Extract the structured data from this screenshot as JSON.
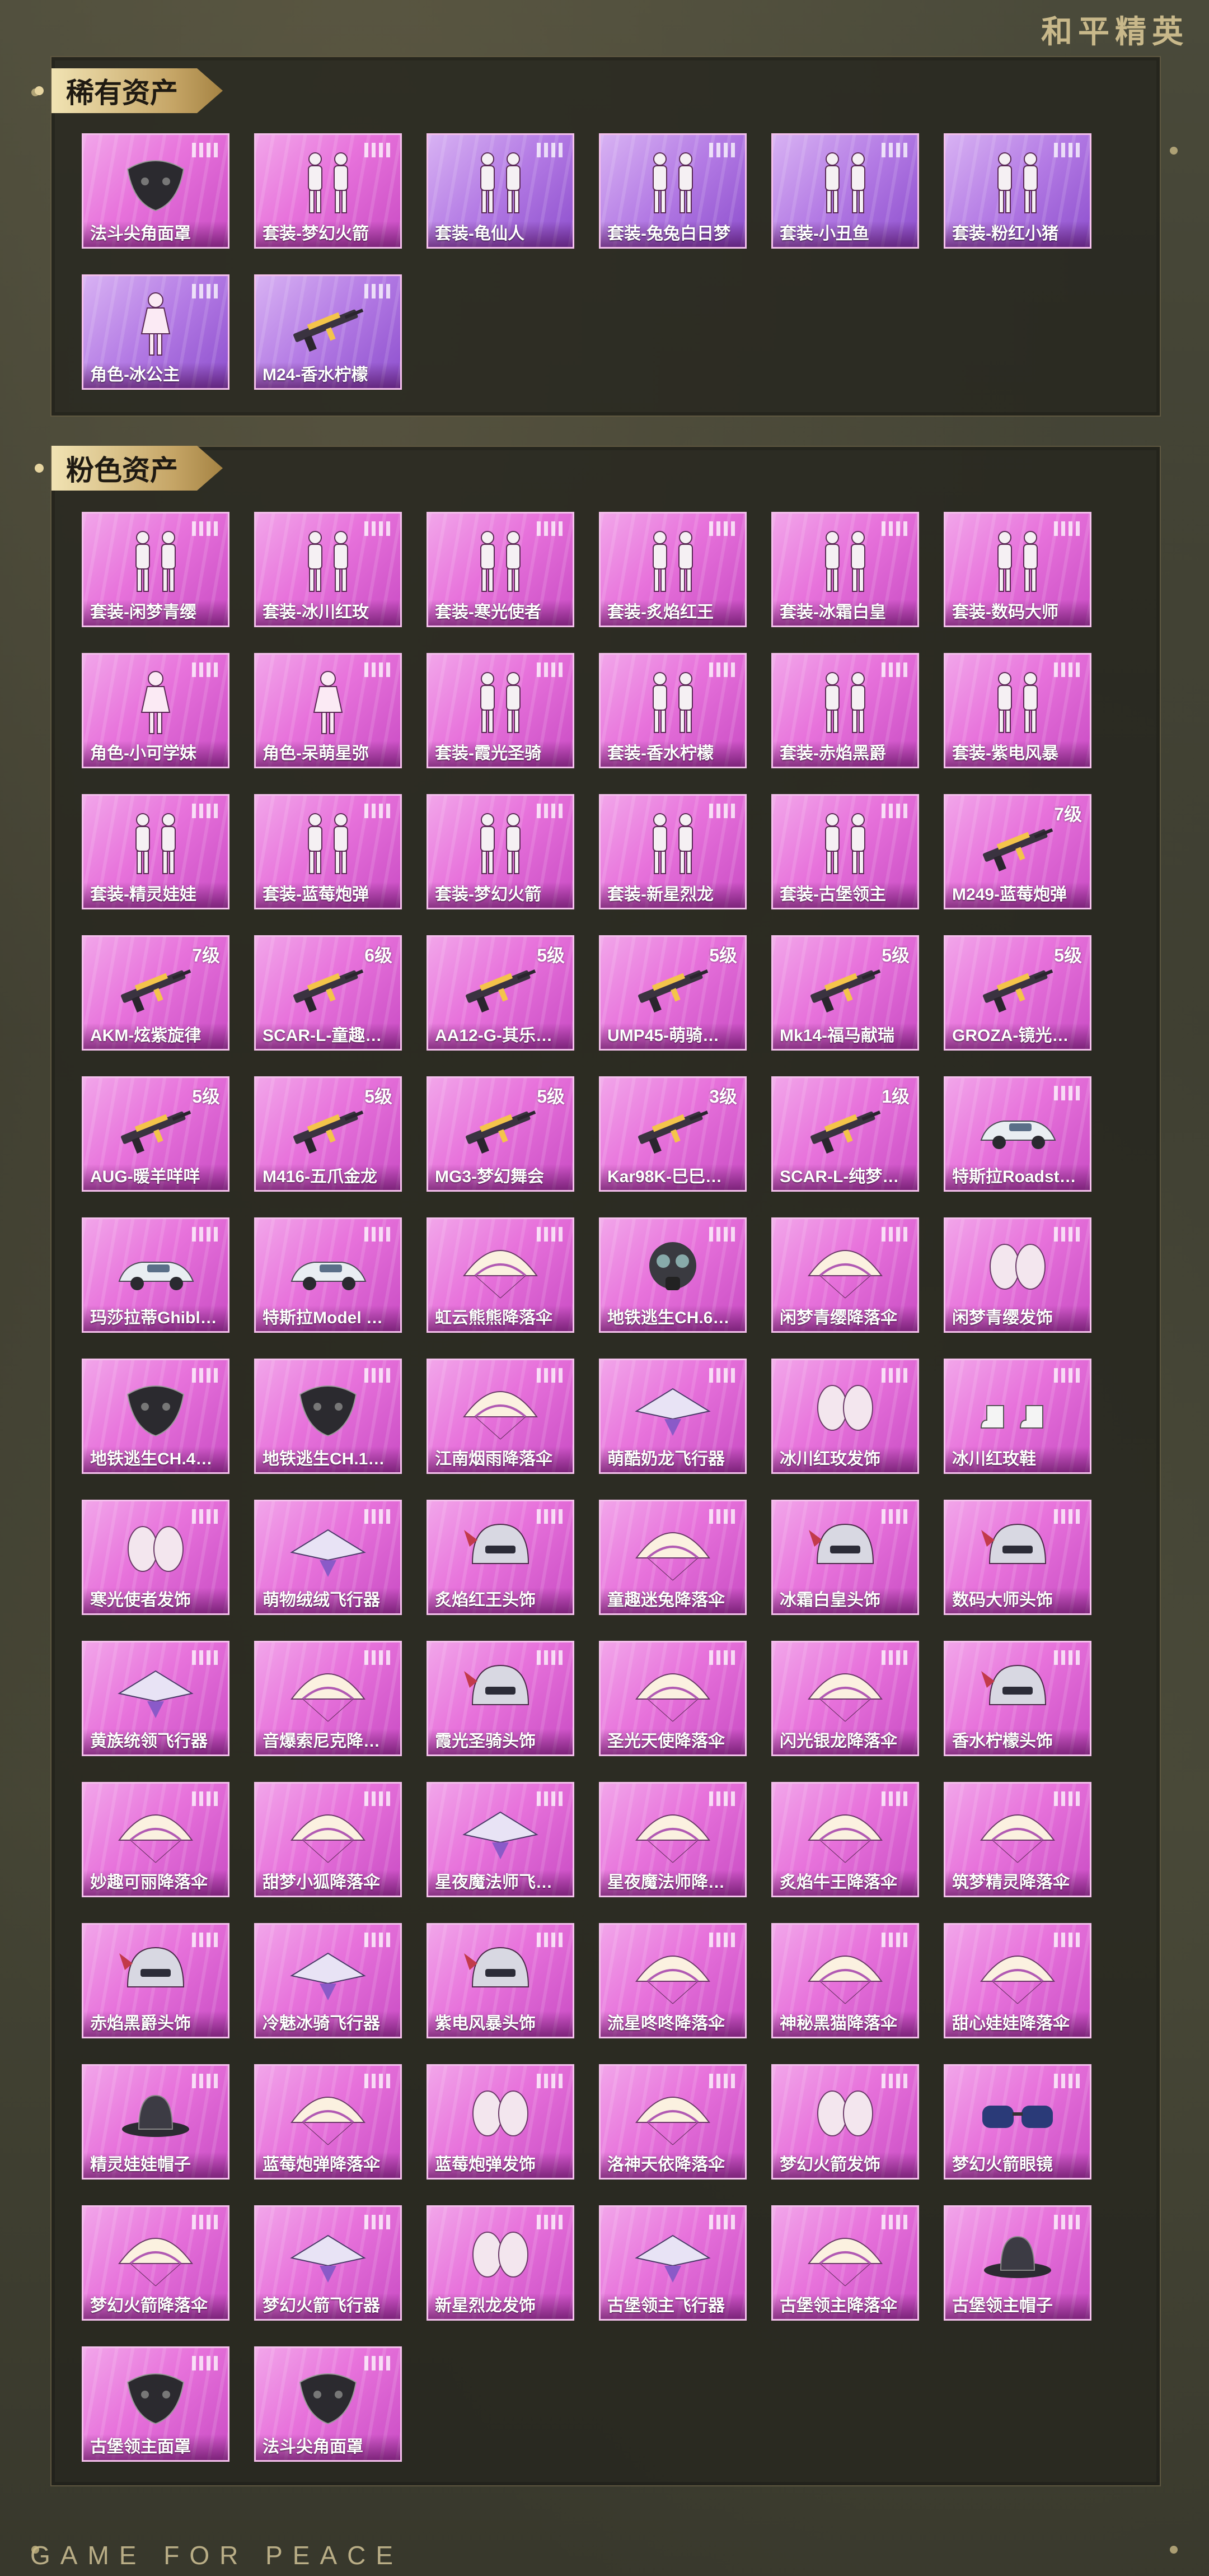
{
  "brand_title": "和平精英",
  "footer_text": "GAME FOR PEACE",
  "colors": {
    "pink": "#e772db",
    "purple": "#b37ae4",
    "gold": "#c6a667"
  },
  "sections": [
    {
      "title": "稀有资产",
      "items": [
        {
          "label": "法斗尖角面罩",
          "icon": "mask-icon",
          "level": "",
          "tone": "pink"
        },
        {
          "label": "套装-梦幻火箭",
          "icon": "outfit-icon",
          "level": "",
          "tone": "pink"
        },
        {
          "label": "套装-龟仙人",
          "icon": "outfit-icon",
          "level": "",
          "tone": "purple"
        },
        {
          "label": "套装-兔兔白日梦",
          "icon": "outfit-icon",
          "level": "",
          "tone": "purple"
        },
        {
          "label": "套装-小丑鱼",
          "icon": "outfit-icon",
          "level": "",
          "tone": "purple"
        },
        {
          "label": "套装-粉红小猪",
          "icon": "outfit-icon",
          "level": "",
          "tone": "purple"
        },
        {
          "label": "角色-冰公主",
          "icon": "character-icon",
          "level": "",
          "tone": "purple"
        },
        {
          "label": "M24-香水柠檬",
          "icon": "rifle-icon",
          "level": "",
          "tone": "purple"
        }
      ]
    },
    {
      "title": "粉色资产",
      "items": [
        {
          "label": "套装-闲梦青缨",
          "icon": "outfit-icon",
          "level": "",
          "tone": "pink"
        },
        {
          "label": "套装-冰川红玫",
          "icon": "outfit-icon",
          "level": "",
          "tone": "pink"
        },
        {
          "label": "套装-寒光使者",
          "icon": "outfit-icon",
          "level": "",
          "tone": "pink"
        },
        {
          "label": "套装-炙焰红王",
          "icon": "outfit-icon",
          "level": "",
          "tone": "pink"
        },
        {
          "label": "套装-冰霜白皇",
          "icon": "outfit-icon",
          "level": "",
          "tone": "pink"
        },
        {
          "label": "套装-数码大师",
          "icon": "outfit-icon",
          "level": "",
          "tone": "pink"
        },
        {
          "label": "角色-小可学妹",
          "icon": "character-icon",
          "level": "",
          "tone": "pink"
        },
        {
          "label": "角色-呆萌星弥",
          "icon": "character-icon",
          "level": "",
          "tone": "pink"
        },
        {
          "label": "套装-霞光圣骑",
          "icon": "outfit-icon",
          "level": "",
          "tone": "pink"
        },
        {
          "label": "套装-香水柠檬",
          "icon": "outfit-icon",
          "level": "",
          "tone": "pink"
        },
        {
          "label": "套装-赤焰黑爵",
          "icon": "outfit-icon",
          "level": "",
          "tone": "pink"
        },
        {
          "label": "套装-紫电风暴",
          "icon": "outfit-icon",
          "level": "",
          "tone": "pink"
        },
        {
          "label": "套装-精灵娃娃",
          "icon": "outfit-icon",
          "level": "",
          "tone": "pink"
        },
        {
          "label": "套装-蓝莓炮弹",
          "icon": "outfit-icon",
          "level": "",
          "tone": "pink"
        },
        {
          "label": "套装-梦幻火箭",
          "icon": "outfit-icon",
          "level": "",
          "tone": "pink"
        },
        {
          "label": "套装-新星烈龙",
          "icon": "outfit-icon",
          "level": "",
          "tone": "pink"
        },
        {
          "label": "套装-古堡领主",
          "icon": "outfit-icon",
          "level": "",
          "tone": "pink"
        },
        {
          "label": "M249-蓝莓炮弹",
          "icon": "rifle-icon",
          "level": "7级",
          "tone": "pink"
        },
        {
          "label": "AKM-炫紫旋律",
          "icon": "rifle-icon",
          "level": "7级",
          "tone": "pink"
        },
        {
          "label": "SCAR-L-童趣…",
          "icon": "rifle-icon",
          "level": "6级",
          "tone": "pink"
        },
        {
          "label": "AA12-G-其乐…",
          "icon": "rifle-icon",
          "level": "5级",
          "tone": "pink"
        },
        {
          "label": "UMP45-萌骑…",
          "icon": "rifle-icon",
          "level": "5级",
          "tone": "pink"
        },
        {
          "label": "Mk14-福马献瑞",
          "icon": "rifle-icon",
          "level": "5级",
          "tone": "pink"
        },
        {
          "label": "GROZA-镜光…",
          "icon": "rifle-icon",
          "level": "5级",
          "tone": "pink"
        },
        {
          "label": "AUG-暖羊咩咩",
          "icon": "rifle-icon",
          "level": "5级",
          "tone": "pink"
        },
        {
          "label": "M416-五爪金龙",
          "icon": "rifle-icon",
          "level": "5级",
          "tone": "pink"
        },
        {
          "label": "MG3-梦幻舞会",
          "icon": "rifle-icon",
          "level": "5级",
          "tone": "pink"
        },
        {
          "label": "Kar98K-巳巳…",
          "icon": "rifle-icon",
          "level": "3级",
          "tone": "pink"
        },
        {
          "label": "SCAR-L-纯梦…",
          "icon": "rifle-icon",
          "level": "1级",
          "tone": "pink"
        },
        {
          "label": "特斯拉Roadst…",
          "icon": "car-icon",
          "level": "",
          "tone": "pink"
        },
        {
          "label": "玛莎拉蒂Ghibl…",
          "icon": "car-icon",
          "level": "",
          "tone": "pink"
        },
        {
          "label": "特斯拉Model …",
          "icon": "car-icon",
          "level": "",
          "tone": "pink"
        },
        {
          "label": "虹云熊熊降落伞",
          "icon": "parachute-icon",
          "level": "",
          "tone": "pink"
        },
        {
          "label": "地铁逃生CH.6…",
          "icon": "gasmask-icon",
          "level": "",
          "tone": "pink"
        },
        {
          "label": "闲梦青缨降落伞",
          "icon": "parachute-icon",
          "level": "",
          "tone": "pink"
        },
        {
          "label": "闲梦青缨发饰",
          "icon": "hair-icon",
          "level": "",
          "tone": "pink"
        },
        {
          "label": "地铁逃生CH.4…",
          "icon": "mask-icon",
          "level": "",
          "tone": "pink"
        },
        {
          "label": "地铁逃生CH.1…",
          "icon": "mask-icon",
          "level": "",
          "tone": "pink"
        },
        {
          "label": "江南烟雨降落伞",
          "icon": "parachute-icon",
          "level": "",
          "tone": "pink"
        },
        {
          "label": "萌酷奶龙飞行器",
          "icon": "glider-icon",
          "level": "",
          "tone": "pink"
        },
        {
          "label": "冰川红玫发饰",
          "icon": "hair-icon",
          "level": "",
          "tone": "pink"
        },
        {
          "label": "冰川红玫鞋",
          "icon": "shoes-icon",
          "level": "",
          "tone": "pink"
        },
        {
          "label": "寒光使者发饰",
          "icon": "hair-icon",
          "level": "",
          "tone": "pink"
        },
        {
          "label": "萌物绒绒飞行器",
          "icon": "glider-icon",
          "level": "",
          "tone": "pink"
        },
        {
          "label": "炙焰红王头饰",
          "icon": "helmet-icon",
          "level": "",
          "tone": "pink"
        },
        {
          "label": "童趣迷兔降落伞",
          "icon": "parachute-icon",
          "level": "",
          "tone": "pink"
        },
        {
          "label": "冰霜白皇头饰",
          "icon": "helmet-icon",
          "level": "",
          "tone": "pink"
        },
        {
          "label": "数码大师头饰",
          "icon": "helmet-icon",
          "level": "",
          "tone": "pink"
        },
        {
          "label": "黄族统领飞行器",
          "icon": "glider-icon",
          "level": "",
          "tone": "pink"
        },
        {
          "label": "音爆索尼克降…",
          "icon": "parachute-icon",
          "level": "",
          "tone": "pink"
        },
        {
          "label": "霞光圣骑头饰",
          "icon": "helmet-icon",
          "level": "",
          "tone": "pink"
        },
        {
          "label": "圣光天使降落伞",
          "icon": "parachute-icon",
          "level": "",
          "tone": "pink"
        },
        {
          "label": "闪光银龙降落伞",
          "icon": "parachute-icon",
          "level": "",
          "tone": "pink"
        },
        {
          "label": "香水柠檬头饰",
          "icon": "helmet-icon",
          "level": "",
          "tone": "pink"
        },
        {
          "label": "妙趣可丽降落伞",
          "icon": "parachute-icon",
          "level": "",
          "tone": "pink"
        },
        {
          "label": "甜梦小狐降落伞",
          "icon": "parachute-icon",
          "level": "",
          "tone": "pink"
        },
        {
          "label": "星夜魔法师飞…",
          "icon": "glider-icon",
          "level": "",
          "tone": "pink"
        },
        {
          "label": "星夜魔法师降…",
          "icon": "parachute-icon",
          "level": "",
          "tone": "pink"
        },
        {
          "label": "炙焰牛王降落伞",
          "icon": "parachute-icon",
          "level": "",
          "tone": "pink"
        },
        {
          "label": "筑梦精灵降落伞",
          "icon": "parachute-icon",
          "level": "",
          "tone": "pink"
        },
        {
          "label": "赤焰黑爵头饰",
          "icon": "helmet-icon",
          "level": "",
          "tone": "pink"
        },
        {
          "label": "冷魅冰骑飞行器",
          "icon": "glider-icon",
          "level": "",
          "tone": "pink"
        },
        {
          "label": "紫电风暴头饰",
          "icon": "helmet-icon",
          "level": "",
          "tone": "pink"
        },
        {
          "label": "流星咚咚降落伞",
          "icon": "parachute-icon",
          "level": "",
          "tone": "pink"
        },
        {
          "label": "神秘黑猫降落伞",
          "icon": "parachute-icon",
          "level": "",
          "tone": "pink"
        },
        {
          "label": "甜心娃娃降落伞",
          "icon": "parachute-icon",
          "level": "",
          "tone": "pink"
        },
        {
          "label": "精灵娃娃帽子",
          "icon": "hat-icon",
          "level": "",
          "tone": "pink"
        },
        {
          "label": "蓝莓炮弹降落伞",
          "icon": "parachute-icon",
          "level": "",
          "tone": "pink"
        },
        {
          "label": "蓝莓炮弹发饰",
          "icon": "hair-icon",
          "level": "",
          "tone": "pink"
        },
        {
          "label": "洛神天依降落伞",
          "icon": "parachute-icon",
          "level": "",
          "tone": "pink"
        },
        {
          "label": "梦幻火箭发饰",
          "icon": "hair-icon",
          "level": "",
          "tone": "pink"
        },
        {
          "label": "梦幻火箭眼镜",
          "icon": "glasses-icon",
          "level": "",
          "tone": "pink"
        },
        {
          "label": "梦幻火箭降落伞",
          "icon": "parachute-icon",
          "level": "",
          "tone": "pink"
        },
        {
          "label": "梦幻火箭飞行器",
          "icon": "glider-icon",
          "level": "",
          "tone": "pink"
        },
        {
          "label": "新星烈龙发饰",
          "icon": "hair-icon",
          "level": "",
          "tone": "pink"
        },
        {
          "label": "古堡领主飞行器",
          "icon": "glider-icon",
          "level": "",
          "tone": "pink"
        },
        {
          "label": "古堡领主降落伞",
          "icon": "parachute-icon",
          "level": "",
          "tone": "pink"
        },
        {
          "label": "古堡领主帽子",
          "icon": "hat-icon",
          "level": "",
          "tone": "pink"
        },
        {
          "label": "古堡领主面罩",
          "icon": "mask-icon",
          "level": "",
          "tone": "pink"
        },
        {
          "label": "法斗尖角面罩",
          "icon": "mask-icon",
          "level": "",
          "tone": "pink"
        }
      ]
    }
  ]
}
